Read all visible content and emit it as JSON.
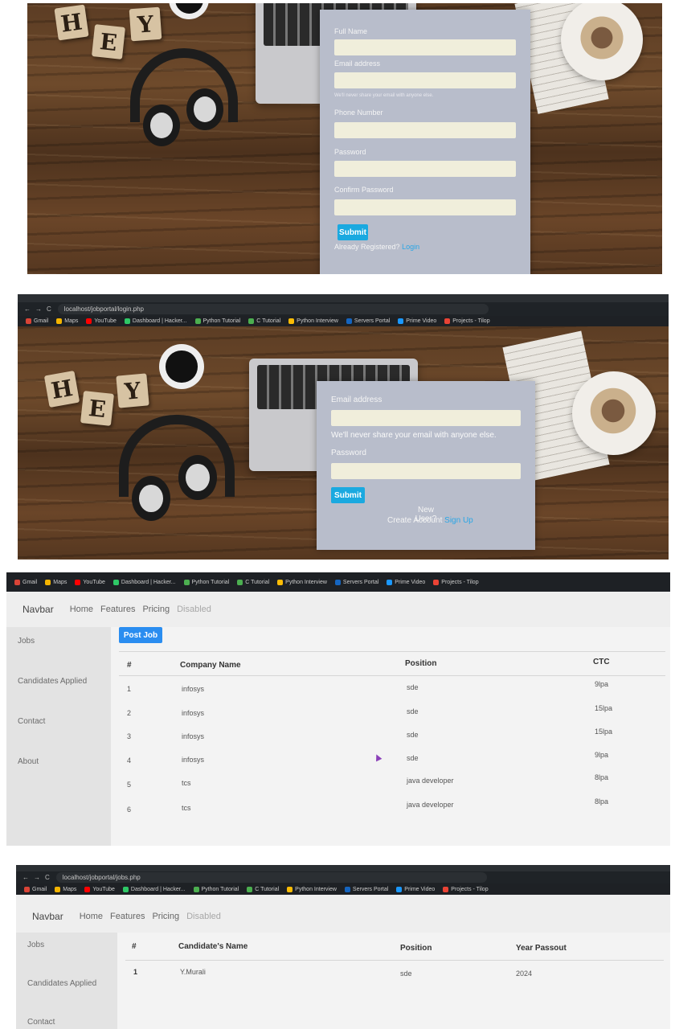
{
  "signup": {
    "fields": [
      {
        "label": "Full Name",
        "value": ""
      },
      {
        "label": "Email address",
        "value": ""
      },
      {
        "label": "Phone Number",
        "value": ""
      },
      {
        "label": "Password",
        "value": ""
      },
      {
        "label": "Confirm Password",
        "value": ""
      }
    ],
    "email_help": "We'll never share your email with anyone else.",
    "submit_label": "Submit",
    "already_text": "Already Registered?",
    "login_link": "Login",
    "blocks": [
      "H",
      "E",
      "Y"
    ]
  },
  "login": {
    "url": "localhost/jobportal/login.php",
    "bookmarks": [
      "Gmail",
      "Maps",
      "YouTube",
      "Dashboard | Hacker...",
      "Python Tutorial",
      "C Tutorial",
      "Python Interview",
      "Servers Portal",
      "Prime Video",
      "Projects - Tilop"
    ],
    "email_label": "Email address",
    "email_value": "",
    "email_help": "We'll never share your email with anyone else.",
    "password_label": "Password",
    "password_value": "",
    "submit_label": "Submit",
    "new_user_text": "New User?",
    "create_text": "Create Account",
    "signup_link": "Sign Up",
    "blocks": [
      "H",
      "E",
      "Y"
    ]
  },
  "jobs_page": {
    "bookmarks": [
      "Gmail",
      "Maps",
      "YouTube",
      "Dashboard | Hacker...",
      "Python Tutorial",
      "C Tutorial",
      "Python Interview",
      "Servers Portal",
      "Prime Video",
      "Projects - Tilop"
    ],
    "navbar": {
      "brand": "Navbar",
      "links": [
        "Home",
        "Features",
        "Pricing"
      ],
      "disabled": "Disabled"
    },
    "sidebar": [
      "Jobs",
      "Candidates Applied",
      "Contact",
      "About"
    ],
    "post_button": "Post Job",
    "headers": [
      "#",
      "Company Name",
      "Position",
      "CTC"
    ],
    "rows": [
      [
        "1",
        "infosys",
        "sde",
        "9lpa"
      ],
      [
        "2",
        "infosys",
        "sde",
        "15lpa"
      ],
      [
        "3",
        "infosys",
        "sde",
        "15lpa"
      ],
      [
        "4",
        "infosys",
        "sde",
        "9lpa"
      ],
      [
        "5",
        "tcs",
        "java developer",
        "8lpa"
      ],
      [
        "6",
        "tcs",
        "java developer",
        "8lpa"
      ]
    ]
  },
  "candidates_page": {
    "url": "localhost/jobportal/jobs.php",
    "bookmarks": [
      "Gmail",
      "Maps",
      "YouTube",
      "Dashboard | Hacker...",
      "Python Tutorial",
      "C Tutorial",
      "Python Interview",
      "Servers Portal",
      "Prime Video",
      "Projects - Tilop"
    ],
    "navbar": {
      "brand": "Navbar",
      "links": [
        "Home",
        "Features",
        "Pricing"
      ],
      "disabled": "Disabled"
    },
    "sidebar": [
      "Jobs",
      "Candidates Applied",
      "Contact"
    ],
    "headers": [
      "#",
      "Candidate's Name",
      "Position",
      "Year Passout"
    ],
    "rows": [
      [
        "1",
        "Y.Murali",
        "sde",
        "2024"
      ]
    ]
  },
  "colors": {
    "submit": "#1aa9e0",
    "post_job": "#2a8df0",
    "link": "#2aa6e6",
    "form_card": "#b8bdcb"
  }
}
